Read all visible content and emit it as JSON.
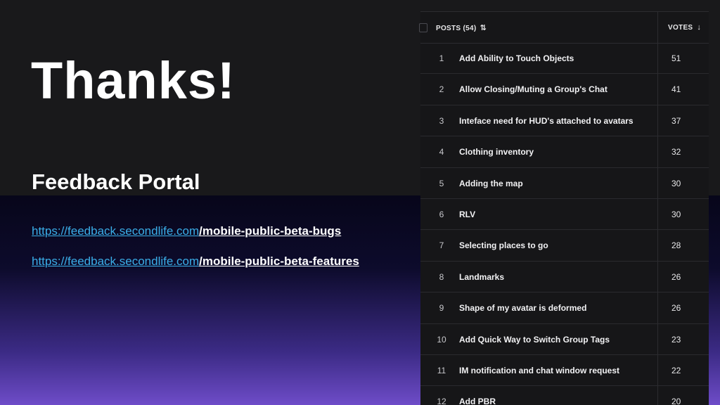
{
  "slide": {
    "title": "Thanks!",
    "subtitle": "Feedback Portal",
    "links": [
      {
        "base": "https://feedback.secondlife.com",
        "path": "/mobile-public-beta-bugs"
      },
      {
        "base": "https://feedback.secondlife.com",
        "path": "/mobile-public-beta-features"
      }
    ]
  },
  "table": {
    "posts_header": "POSTS (54)",
    "sort_icon": "⇅",
    "votes_header": "VOTES",
    "votes_sort_icon": "↓",
    "rows": [
      {
        "rank": "1",
        "title": "Add Ability to Touch Objects",
        "votes": "51"
      },
      {
        "rank": "2",
        "title": "Allow Closing/Muting a Group's Chat",
        "votes": "41"
      },
      {
        "rank": "3",
        "title": "Inteface need for HUD's attached to avatars",
        "votes": "37"
      },
      {
        "rank": "4",
        "title": "Clothing inventory",
        "votes": "32"
      },
      {
        "rank": "5",
        "title": "Adding the map",
        "votes": "30"
      },
      {
        "rank": "6",
        "title": "RLV",
        "votes": "30"
      },
      {
        "rank": "7",
        "title": "Selecting places to go",
        "votes": "28"
      },
      {
        "rank": "8",
        "title": "Landmarks",
        "votes": "26"
      },
      {
        "rank": "9",
        "title": "Shape of my avatar is deformed",
        "votes": "26"
      },
      {
        "rank": "10",
        "title": "Add Quick Way to Switch Group Tags",
        "votes": "23"
      },
      {
        "rank": "11",
        "title": "IM notification and chat window request",
        "votes": "22"
      },
      {
        "rank": "12",
        "title": "Add PBR",
        "votes": "20"
      }
    ]
  }
}
